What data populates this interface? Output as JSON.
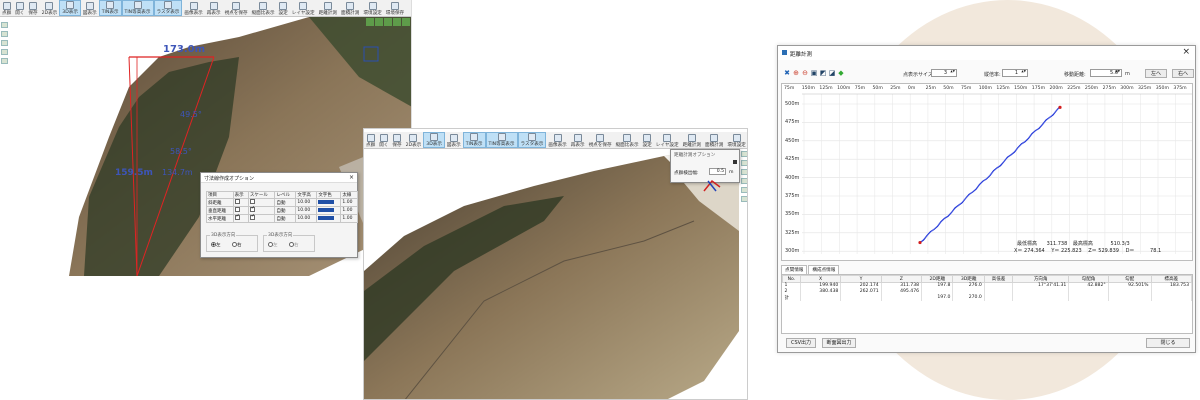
{
  "shot1": {
    "toolbar": [
      "点群",
      "開く",
      "保存",
      "2D表示",
      "3D表示",
      "図表示",
      "TIN表示",
      "TIN等高表示",
      "ラスタ表示",
      "画像表示",
      "再表示",
      "視点を保存",
      "縦面比表示",
      "設定",
      "レイヤ設定",
      "距離計測",
      "面積計測",
      "環境設定",
      "環境保存"
    ],
    "measurements": {
      "top_width": "173.0m",
      "length": "159.5m",
      "length2": "134.7m",
      "slope": "49.5°",
      "angle": "58.5°"
    },
    "dialog": {
      "title": "寸法線作成オプション",
      "columns": [
        "項目",
        "表示",
        "スケール",
        "レベル",
        "文字高",
        "文字色",
        "太線"
      ],
      "rows": [
        {
          "name": "斜距離",
          "show": false,
          "scale": false,
          "level": "自動",
          "height": "10.00",
          "width": "1.00"
        },
        {
          "name": "垂直距離",
          "show": false,
          "scale": true,
          "level": "自動",
          "height": "10.00",
          "width": "1.00"
        },
        {
          "name": "水平距離",
          "show": true,
          "scale": true,
          "level": "自動",
          "height": "10.00",
          "width": "1.00"
        }
      ],
      "group1": {
        "title": "3D表示方向",
        "opt1": "左",
        "opt2": "右"
      },
      "group2": {
        "title": "3D表示方向",
        "opt1": "左",
        "opt2": "右"
      }
    }
  },
  "shot2": {
    "toolbar": [
      "点群",
      "開く",
      "保存",
      "2D表示",
      "3D表示",
      "図表示",
      "TIN表示",
      "TIN等高表示",
      "ラスタ表示",
      "画像表示",
      "再表示",
      "視点を保存",
      "縦面比表示",
      "設定",
      "レイヤ設定",
      "距離計測",
      "面積計測",
      "環境設定",
      "環境保存"
    ],
    "panel": {
      "title": "距離計測オプション",
      "label": "点群検出幅:",
      "value": "0.5",
      "unit": "m"
    }
  },
  "dialog": {
    "title": "距離計測",
    "point_size_label": "点表示サイズ:",
    "point_size": "3",
    "scale_label": "縦倍率:",
    "scale": "1",
    "move_label": "移動距離:",
    "move": "5.0",
    "move_unit": "m",
    "left_btn": "左へ",
    "right_btn": "右へ",
    "x_ticks": [
      "75m",
      "150m",
      "125m",
      "100m",
      "75m",
      "50m",
      "25m",
      "0m",
      "25m",
      "50m",
      "75m",
      "100m",
      "125m",
      "150m",
      "175m",
      "200m",
      "225m",
      "250m",
      "275m",
      "300m",
      "325m",
      "350m",
      "375m"
    ],
    "y_ticks": [
      "500m",
      "475m",
      "450m",
      "425m",
      "400m",
      "375m",
      "350m",
      "325m",
      "300m"
    ],
    "status": {
      "min_label": "最低標高",
      "min_val": "311.738",
      "max_label": "最高標高",
      "max_val": "510.3/3",
      "x_label": "X＝",
      "x_val": "274.364",
      "y_label": "Y＝",
      "y_val": "225.823",
      "z_label": "Z＝",
      "z_val": "529.839",
      "d_label": "D＝",
      "d_val": "78.1"
    },
    "tabs": [
      "点間情報",
      "構成点情報"
    ],
    "table": {
      "headers": [
        "No.",
        "X",
        "Y",
        "Z",
        "2D距離",
        "3D距離",
        "高低差",
        "方向角",
        "勾配角",
        "勾配",
        "標高差"
      ],
      "rows": [
        [
          "1",
          "199.940",
          "202.174",
          "311.738",
          "197.8",
          "276.0",
          "",
          "17°37'41.31",
          "42.882°",
          "92.501%",
          "183.753"
        ],
        [
          "2",
          "380.438",
          "262.071",
          "495.476",
          "",
          "",
          "",
          "",
          "",
          "",
          ""
        ],
        [
          "計",
          "",
          "",
          "",
          "197.0",
          "270.0",
          "",
          "",
          "",
          "",
          ""
        ]
      ]
    },
    "buttons": {
      "csv": "CSV出力",
      "section": "断面図出力",
      "close": "閉じる"
    },
    "plot": {
      "start_z": 311.738,
      "end_z": 495.476
    }
  }
}
